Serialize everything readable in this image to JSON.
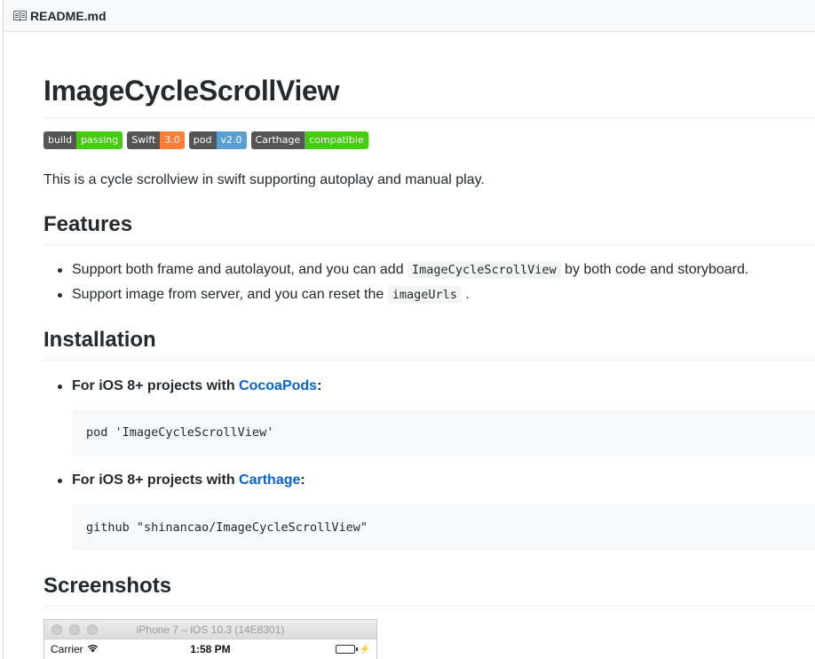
{
  "file_header": {
    "filename": "README.md",
    "icon": "book-icon"
  },
  "readme": {
    "title": "ImageCycleScrollView",
    "badges": [
      {
        "label": "build",
        "value": "passing",
        "color": "#4c1"
      },
      {
        "label": "Swift",
        "value": "3.0",
        "color": "#fe7d37"
      },
      {
        "label": "pod",
        "value": "v2.0",
        "color": "#5a9fd4"
      },
      {
        "label": "Carthage",
        "value": "compatible",
        "color": "#4c1"
      }
    ],
    "intro": "This is a cycle scrollview in swift supporting autoplay and manual play.",
    "features": {
      "heading": "Features",
      "items": [
        {
          "before": "Support both frame and autolayout, and you can add ",
          "code": "ImageCycleScrollView",
          "after": " by both code and storyboard."
        },
        {
          "before": "Support image from server, and you can reset the ",
          "code": "imageUrls",
          "after": " ."
        }
      ]
    },
    "installation": {
      "heading": "Installation",
      "items": [
        {
          "prefix": "For iOS 8+ projects with ",
          "link": "CocoaPods",
          "suffix": ":",
          "code": "pod 'ImageCycleScrollView'"
        },
        {
          "prefix": "For iOS 8+ projects with ",
          "link": "Carthage",
          "suffix": ":",
          "code": "github \"shinancao/ImageCycleScrollView\""
        }
      ]
    },
    "screenshots": {
      "heading": "Screenshots",
      "simulator": {
        "title": "iPhone 7 – iOS 10.3 (14E8301)",
        "carrier": "Carrier",
        "time": "1:58 PM",
        "battery_level": 1.0
      }
    }
  },
  "colors": {
    "link": "#0366d6",
    "battery": "#4cd964"
  }
}
